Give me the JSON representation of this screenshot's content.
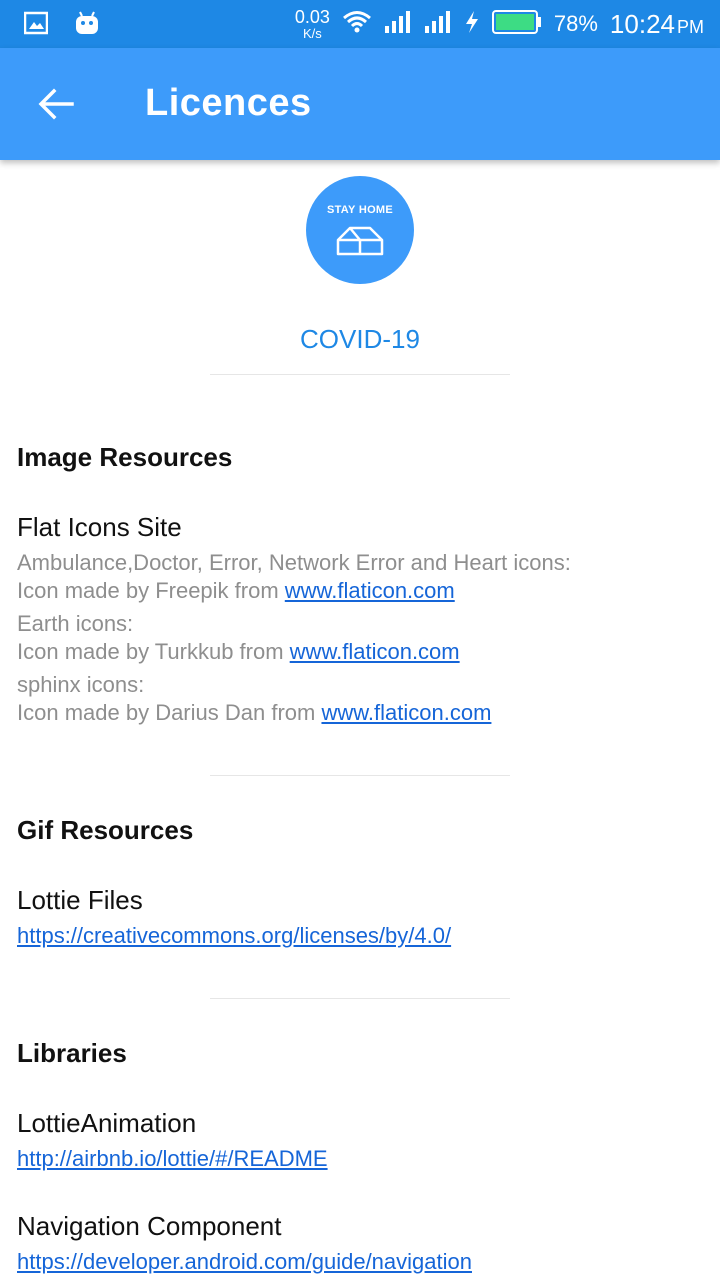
{
  "status_bar": {
    "net_speed_value": "0.03",
    "net_speed_unit": "K/s",
    "battery_percent": "78%",
    "time": "10:24",
    "ampm": "PM",
    "icons": [
      "gallery-icon",
      "android-icon",
      "wifi-icon",
      "signal-icon",
      "signal-icon",
      "charging-icon",
      "battery-icon"
    ]
  },
  "app_bar": {
    "title": "Licences",
    "back_icon": "arrow-back-icon"
  },
  "logo": {
    "badge_text": "STAY HOME",
    "icon": "house-icon",
    "app_name": "COVID-19"
  },
  "sections": {
    "image_resources": {
      "title": "Image Resources",
      "item_title": "Flat Icons Site",
      "entries": [
        {
          "label": "Ambulance,Doctor, Error, Network Error and Heart icons:",
          "credit": "Icon made by Freepik from ",
          "link": "www.flaticon.com"
        },
        {
          "label": "Earth icons:",
          "credit": "Icon made by Turkkub from ",
          "link": "www.flaticon.com"
        },
        {
          "label": "sphinx icons:",
          "credit": "Icon made by Darius Dan from ",
          "link": "www.flaticon.com"
        }
      ]
    },
    "gif_resources": {
      "title": "Gif Resources",
      "item_title": "Lottie Files",
      "link": "https://creativecommons.org/licenses/by/4.0/"
    },
    "libraries": {
      "title": "Libraries",
      "items": [
        {
          "title": "LottieAnimation",
          "link": "http://airbnb.io/lottie/#/README"
        },
        {
          "title": "Navigation Component",
          "link": "https://developer.android.com/guide/navigation"
        }
      ]
    }
  },
  "colors": {
    "status_bar": "#1e88e5",
    "app_bar": "#3d9bfa",
    "accent": "#1e88e5",
    "link": "#1565d8",
    "secondary_text": "#8e8e8e"
  }
}
